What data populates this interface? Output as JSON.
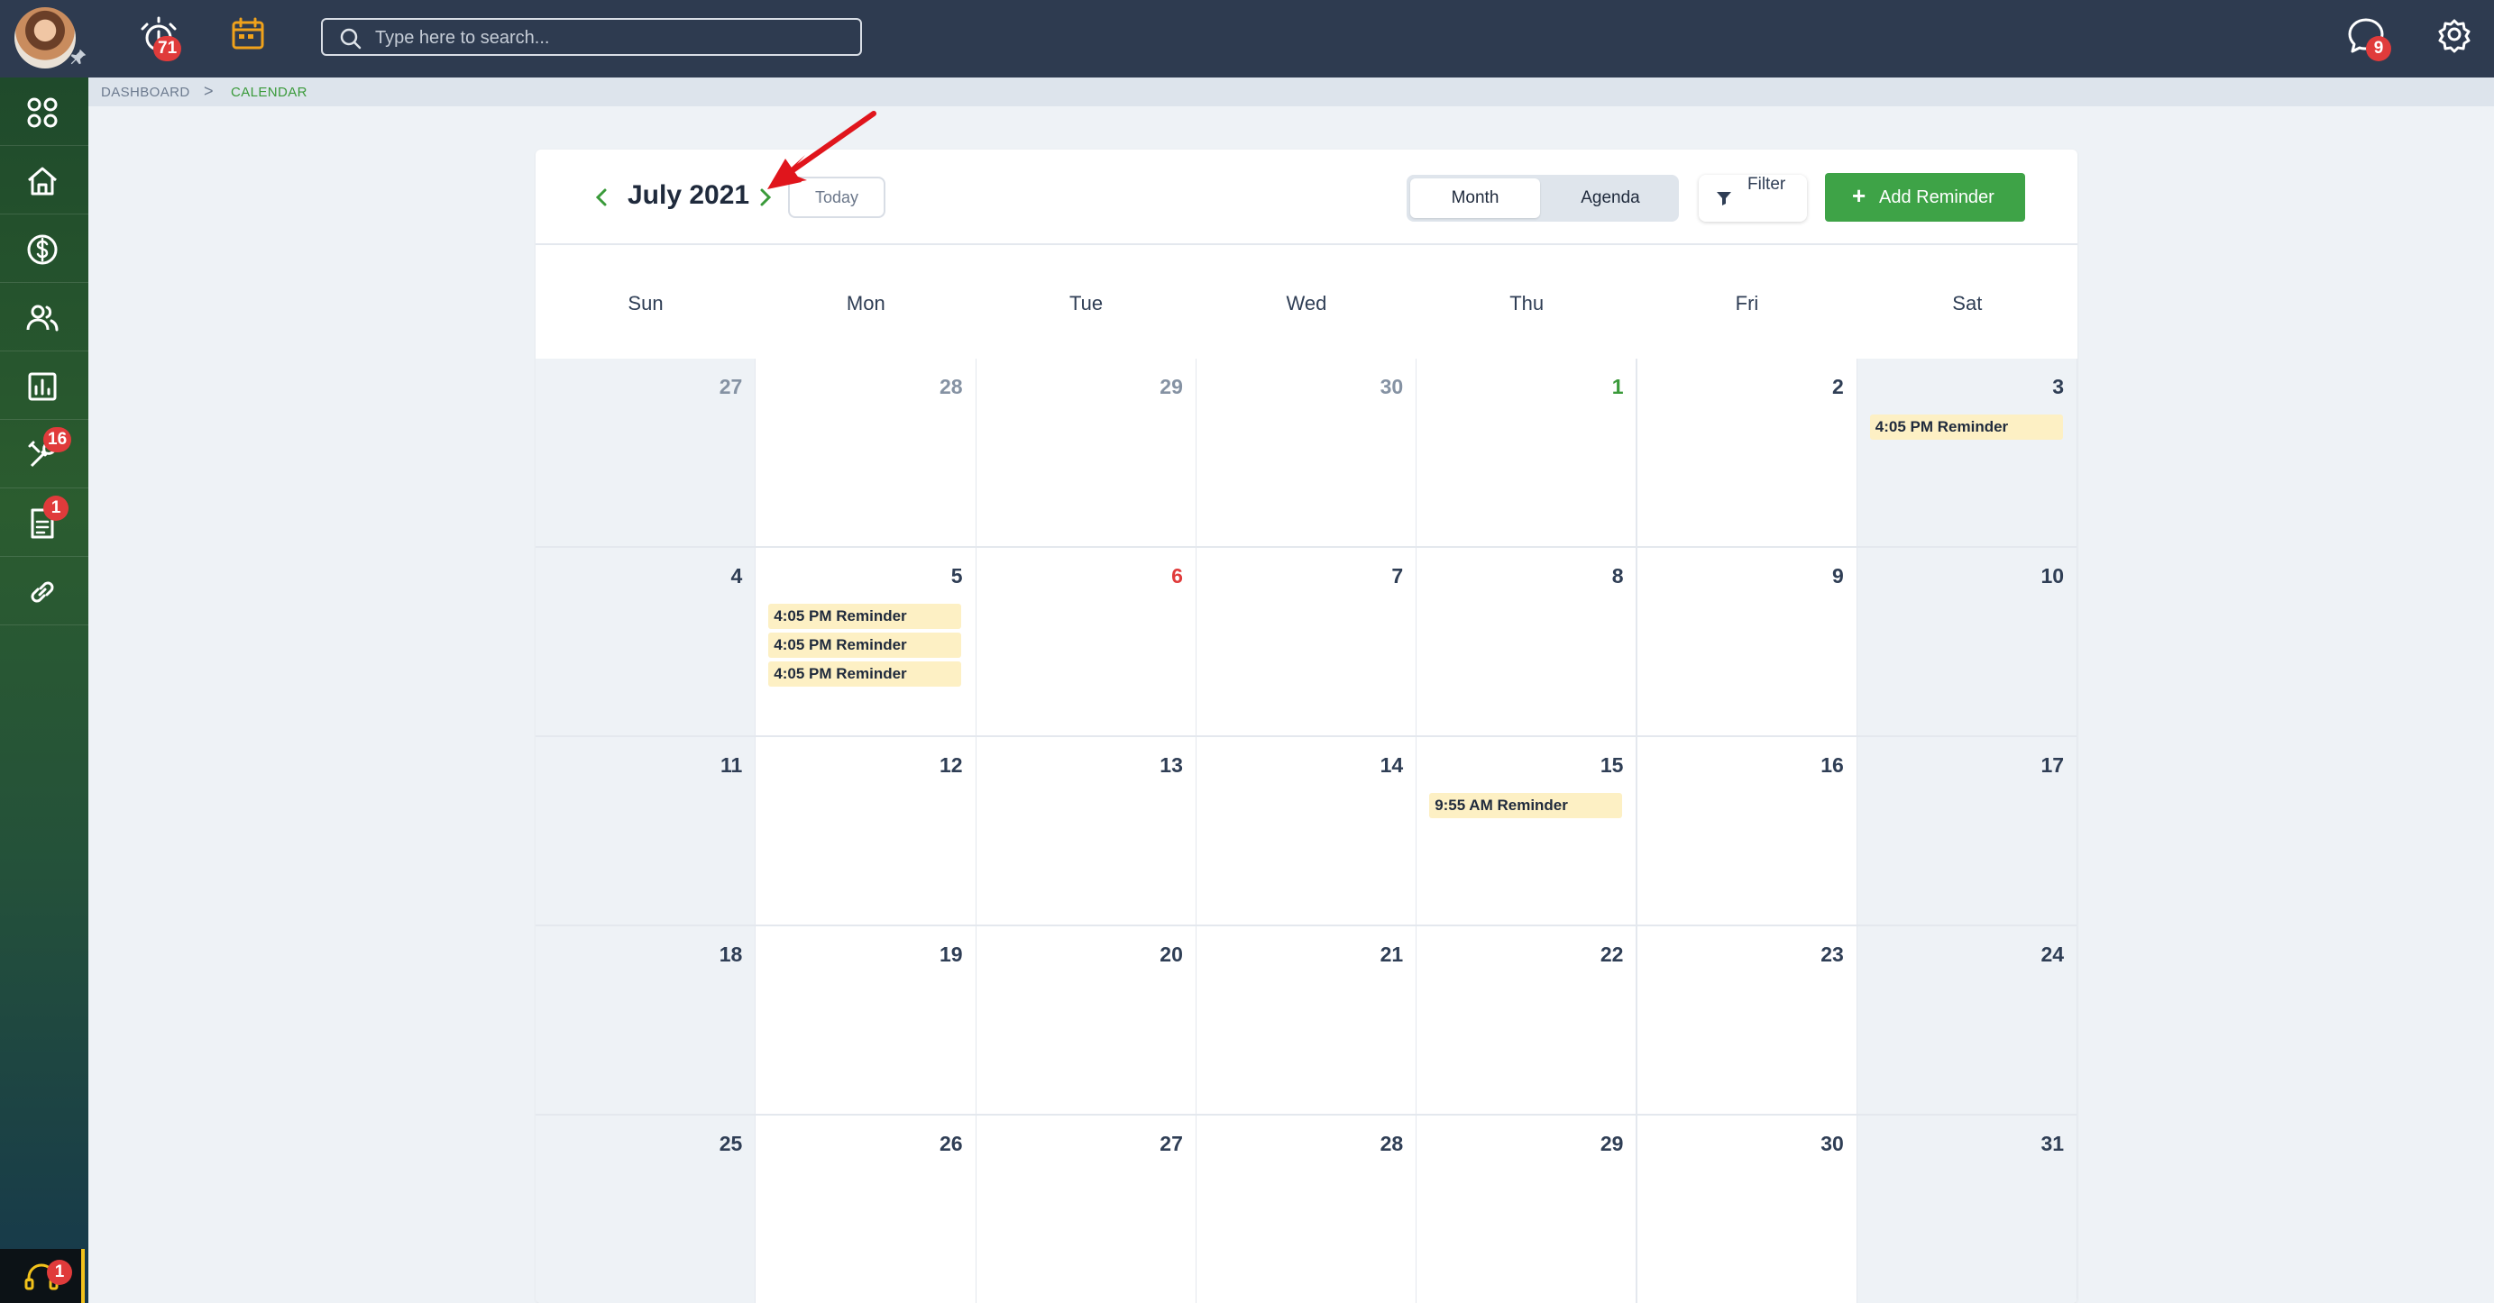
{
  "topbar": {
    "alerts_badge": "71",
    "messages_badge": "9",
    "search_placeholder": "Type here to search..."
  },
  "breadcrumb": {
    "home": "DASHBOARD",
    "separator": ">",
    "current": "CALENDAR"
  },
  "sidebar": {
    "items": [
      {
        "name": "apps-grid-icon"
      },
      {
        "name": "home-icon"
      },
      {
        "name": "dollar-icon"
      },
      {
        "name": "users-icon"
      },
      {
        "name": "chart-icon"
      },
      {
        "name": "tools-icon",
        "badge": "16"
      },
      {
        "name": "document-icon",
        "badge": "1"
      },
      {
        "name": "link-icon"
      }
    ],
    "support_badge": "1"
  },
  "calendar": {
    "title": "July 2021",
    "today_label": "Today",
    "view_month": "Month",
    "view_agenda": "Agenda",
    "filter_label": "Filter",
    "add_label": "Add Reminder",
    "weekdays": [
      "Sun",
      "Mon",
      "Tue",
      "Wed",
      "Thu",
      "Fri",
      "Sat"
    ],
    "weeks": [
      [
        {
          "day": "27",
          "style": "muted",
          "shade": true
        },
        {
          "day": "28",
          "style": "muted"
        },
        {
          "day": "29",
          "style": "muted"
        },
        {
          "day": "30",
          "style": "muted"
        },
        {
          "day": "1",
          "style": "green"
        },
        {
          "day": "2"
        },
        {
          "day": "3",
          "shade": true,
          "events": [
            "4:05 PM Reminder"
          ]
        }
      ],
      [
        {
          "day": "4",
          "shade": true
        },
        {
          "day": "5",
          "events": [
            "4:05 PM Reminder",
            "4:05 PM Reminder",
            "4:05 PM Reminder"
          ]
        },
        {
          "day": "6",
          "style": "red"
        },
        {
          "day": "7"
        },
        {
          "day": "8"
        },
        {
          "day": "9"
        },
        {
          "day": "10",
          "shade": true
        }
      ],
      [
        {
          "day": "11",
          "shade": true
        },
        {
          "day": "12"
        },
        {
          "day": "13"
        },
        {
          "day": "14"
        },
        {
          "day": "15",
          "events": [
            "9:55 AM Reminder"
          ]
        },
        {
          "day": "16"
        },
        {
          "day": "17",
          "shade": true
        }
      ],
      [
        {
          "day": "18",
          "shade": true
        },
        {
          "day": "19"
        },
        {
          "day": "20"
        },
        {
          "day": "21"
        },
        {
          "day": "22"
        },
        {
          "day": "23"
        },
        {
          "day": "24",
          "shade": true
        }
      ],
      [
        {
          "day": "25",
          "shade": true
        },
        {
          "day": "26"
        },
        {
          "day": "27"
        },
        {
          "day": "28"
        },
        {
          "day": "29"
        },
        {
          "day": "30"
        },
        {
          "day": "31",
          "shade": true
        }
      ]
    ]
  },
  "colors": {
    "topbar": "#2e3b50",
    "accent_green": "#3ea347",
    "badge_red": "#e03b3b",
    "event_bg": "#fdf0c4",
    "calendar_icon": "#f0a21b",
    "annotation_arrow": "#e0151c"
  }
}
